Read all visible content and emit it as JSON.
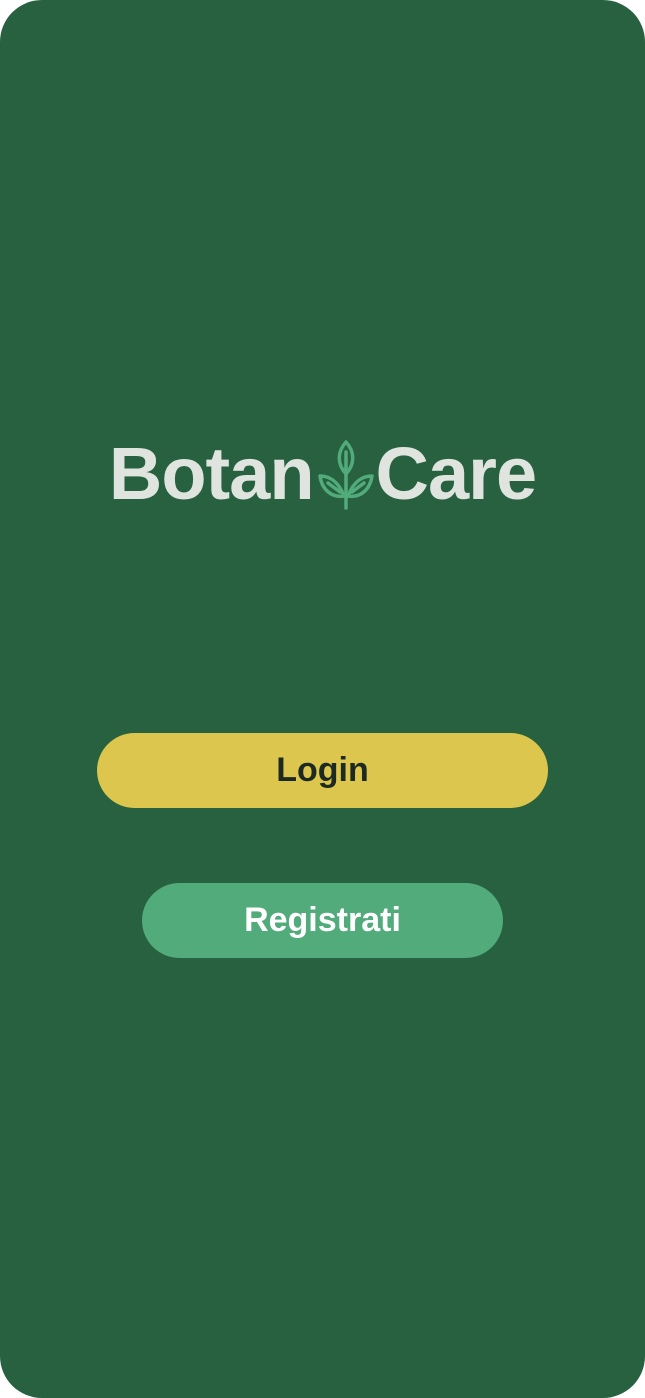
{
  "app": {
    "brand_part1": "Botan",
    "brand_part2": "Care",
    "brand_icon": "sprout-icon"
  },
  "actions": {
    "login_label": "Login",
    "register_label": "Registrati"
  },
  "colors": {
    "background": "#276140",
    "logo_text": "#dfe4df",
    "logo_icon": "#52ab7b",
    "login_button": "#dcc64d",
    "login_text": "#1c2a22",
    "register_button": "#52ab7b",
    "register_text": "#ffffff"
  }
}
